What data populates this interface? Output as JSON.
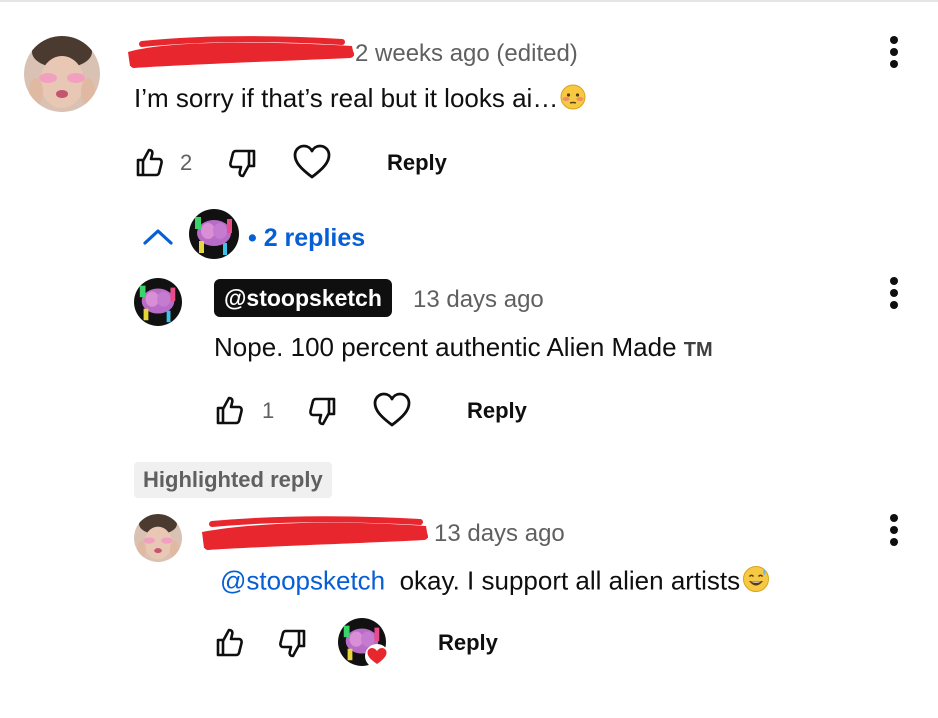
{
  "comment": {
    "time": "2 weeks ago (edited)",
    "text": "I’m sorry if that’s real but it looks ai…",
    "emoji": "flushed-face",
    "likes": "2",
    "reply_label": "Reply"
  },
  "replies_toggle": {
    "label": "• 2 replies"
  },
  "reply1": {
    "handle": "@stoopsketch",
    "time": "13 days ago",
    "text": "Nope. 100 percent authentic Alien Made",
    "trademark": "TM",
    "likes": "1",
    "reply_label": "Reply"
  },
  "reply2": {
    "badge": "Highlighted reply",
    "time": "13 days ago",
    "mention": "@stoopsketch",
    "text": "okay. I support all alien artists",
    "emoji": "grinning-sweat-face",
    "reply_label": "Reply"
  },
  "colors": {
    "redaction": "#e8262d",
    "link": "#065fd4",
    "chip_dark": "#0f0f0f",
    "heart": "#e8262d"
  }
}
